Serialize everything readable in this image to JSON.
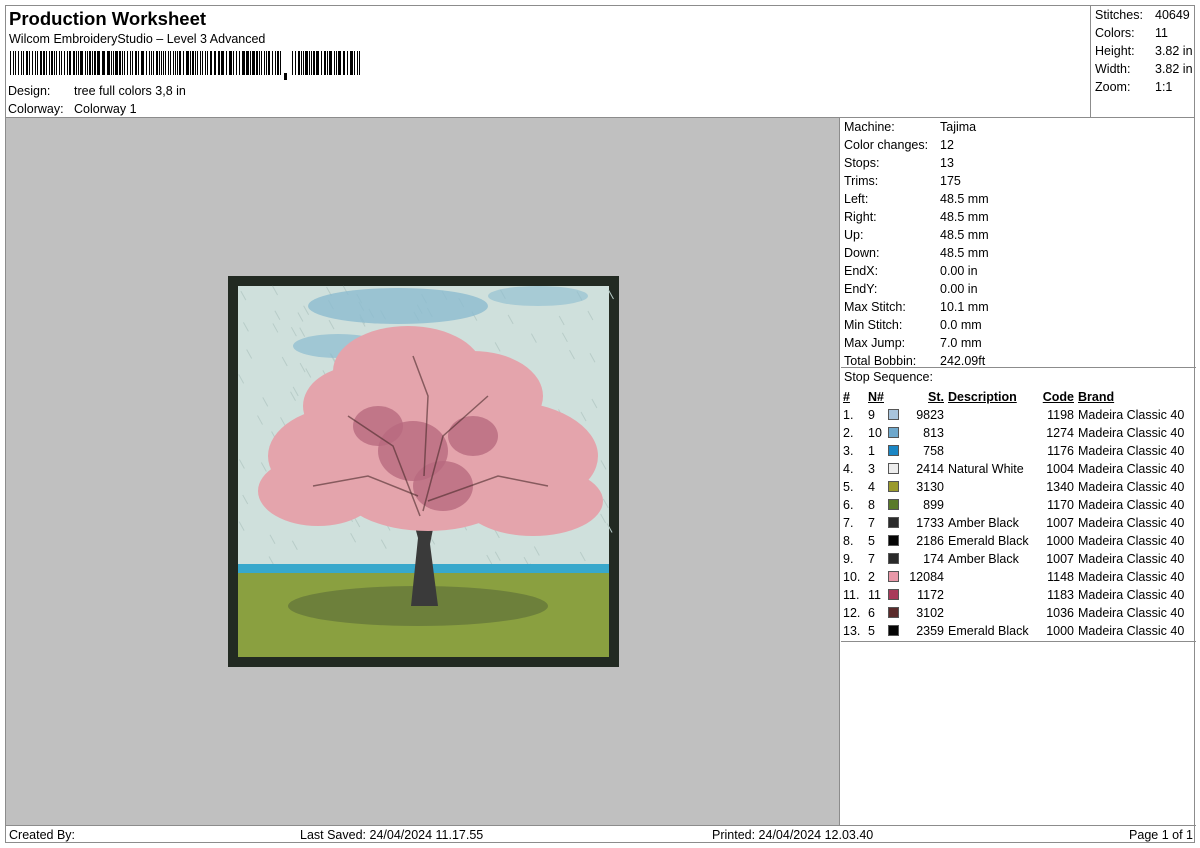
{
  "header": {
    "title": "Production Worksheet",
    "subtitle": "Wilcom EmbroideryStudio – Level 3 Advanced",
    "design_label": "Design:",
    "design_value": "tree full colors 3,8 in",
    "colorway_label": "Colorway:",
    "colorway_value": "Colorway 1"
  },
  "summary": [
    {
      "label": "Stitches:",
      "value": "40649"
    },
    {
      "label": "Colors:",
      "value": "11"
    },
    {
      "label": "Height:",
      "value": "3.82 in"
    },
    {
      "label": "Width:",
      "value": "3.82 in"
    },
    {
      "label": "Zoom:",
      "value": "1:1"
    }
  ],
  "machine_info": [
    {
      "label": "Machine:",
      "value": "Tajima"
    },
    {
      "label": "Color changes:",
      "value": "12"
    },
    {
      "label": "Stops:",
      "value": "13"
    },
    {
      "label": "Trims:",
      "value": "175"
    },
    {
      "label": "Left:",
      "value": "48.5 mm"
    },
    {
      "label": "Right:",
      "value": "48.5 mm"
    },
    {
      "label": "Up:",
      "value": "48.5 mm"
    },
    {
      "label": "Down:",
      "value": "48.5 mm"
    },
    {
      "label": "EndX:",
      "value": "0.00 in"
    },
    {
      "label": "EndY:",
      "value": "0.00 in"
    },
    {
      "label": "Max Stitch:",
      "value": "10.1 mm"
    },
    {
      "label": "Min Stitch:",
      "value": "0.0 mm"
    },
    {
      "label": "Max Jump:",
      "value": "7.0 mm"
    },
    {
      "label": "Total Bobbin:",
      "value": "242.09ft"
    }
  ],
  "stop_sequence": {
    "caption": "Stop Sequence:",
    "headers": [
      "#",
      "N#",
      "St.",
      "Description",
      "Code",
      "Brand"
    ],
    "rows": [
      {
        "idx": "1.",
        "n": "9",
        "color": "#a8c4dc",
        "st": "9823",
        "desc": "",
        "code": "1198",
        "brand": "Madeira Classic 40"
      },
      {
        "idx": "2.",
        "n": "10",
        "color": "#6fa8cc",
        "st": "813",
        "desc": "",
        "code": "1274",
        "brand": "Madeira Classic 40"
      },
      {
        "idx": "3.",
        "n": "1",
        "color": "#1a86c4",
        "st": "758",
        "desc": "",
        "code": "1176",
        "brand": "Madeira Classic 40"
      },
      {
        "idx": "4.",
        "n": "3",
        "color": "#ececec",
        "st": "2414",
        "desc": "Natural White",
        "code": "1004",
        "brand": "Madeira Classic 40"
      },
      {
        "idx": "5.",
        "n": "4",
        "color": "#9a9a2c",
        "st": "3130",
        "desc": "",
        "code": "1340",
        "brand": "Madeira Classic 40"
      },
      {
        "idx": "6.",
        "n": "8",
        "color": "#5a7a2a",
        "st": "899",
        "desc": "",
        "code": "1170",
        "brand": "Madeira Classic 40"
      },
      {
        "idx": "7.",
        "n": "7",
        "color": "#2a2a2a",
        "st": "1733",
        "desc": "Amber Black",
        "code": "1007",
        "brand": "Madeira Classic 40"
      },
      {
        "idx": "8.",
        "n": "5",
        "color": "#050505",
        "st": "2186",
        "desc": "Emerald Black",
        "code": "1000",
        "brand": "Madeira Classic 40"
      },
      {
        "idx": "9.",
        "n": "7",
        "color": "#2a2a2a",
        "st": "174",
        "desc": "Amber Black",
        "code": "1007",
        "brand": "Madeira Classic 40"
      },
      {
        "idx": "10.",
        "n": "2",
        "color": "#e898a8",
        "st": "12084",
        "desc": "",
        "code": "1148",
        "brand": "Madeira Classic 40"
      },
      {
        "idx": "11.",
        "n": "11",
        "color": "#a83a5a",
        "st": "1172",
        "desc": "",
        "code": "1183",
        "brand": "Madeira Classic 40"
      },
      {
        "idx": "12.",
        "n": "6",
        "color": "#5a2a2a",
        "st": "3102",
        "desc": "",
        "code": "1036",
        "brand": "Madeira Classic 40"
      },
      {
        "idx": "13.",
        "n": "5",
        "color": "#050505",
        "st": "2359",
        "desc": "Emerald Black",
        "code": "1000",
        "brand": "Madeira Classic 40"
      }
    ]
  },
  "footer": {
    "created_by": "Created By:",
    "last_saved": "Last Saved: 24/04/2024 11.17.55",
    "printed": "Printed: 24/04/2024 12.03.40",
    "page": "Page 1 of 1"
  },
  "design_colors": {
    "background": "#c0c0c0",
    "patch_border": "#222a22",
    "sky": "#cfe0dc",
    "cloud": "#8cbcd0",
    "horizon": "#38a8cc",
    "grass": "#8aa040",
    "blossom": "#e4a4ac",
    "blossom_dark": "#b86a80",
    "trunk": "#3a3a3a"
  }
}
